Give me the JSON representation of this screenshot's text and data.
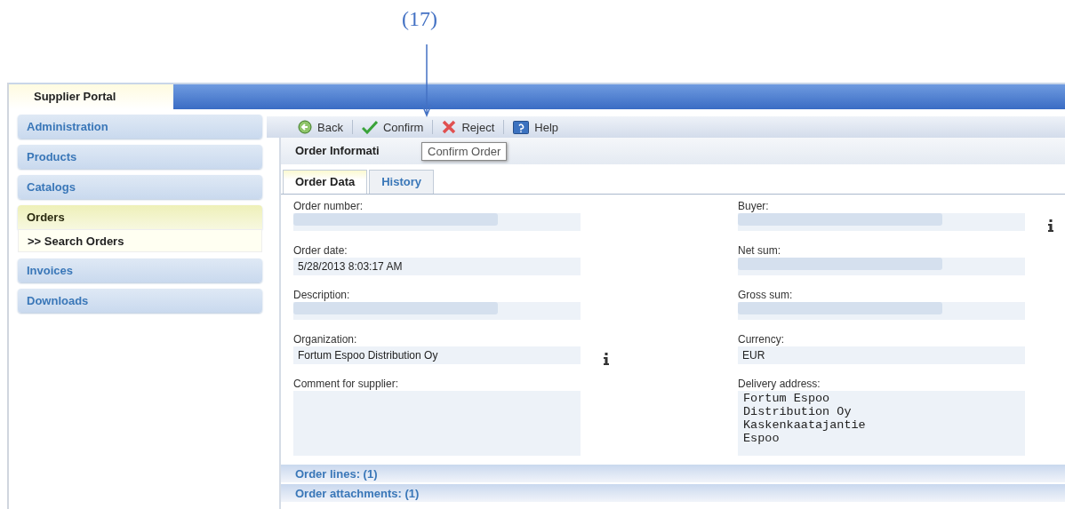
{
  "annotation": {
    "label": "(17)"
  },
  "portal_tab": {
    "label": "Supplier Portal",
    "selected": true
  },
  "sidebar": {
    "items": [
      {
        "label": "Administration",
        "selected": false
      },
      {
        "label": "Products",
        "selected": false
      },
      {
        "label": "Catalogs",
        "selected": false
      },
      {
        "label": "Orders",
        "selected": true,
        "children": [
          {
            "label": ">> Search Orders"
          }
        ]
      },
      {
        "label": "Invoices",
        "selected": false
      },
      {
        "label": "Downloads",
        "selected": false
      }
    ]
  },
  "toolbar": [
    {
      "label": "Back",
      "kind": "back"
    },
    {
      "label": "Confirm",
      "kind": "confirm"
    },
    {
      "label": "Reject",
      "kind": "reject"
    },
    {
      "label": "Help",
      "kind": "help"
    }
  ],
  "tooltip": "Confirm Order",
  "panel": {
    "title": "Order Informati",
    "tabs": [
      {
        "label": "Order Data",
        "selected": true
      },
      {
        "label": "History",
        "selected": false
      }
    ],
    "left_fields": [
      {
        "label": "Order number:",
        "redacted": true,
        "info": false,
        "kind": "text"
      },
      {
        "label": "Order date:",
        "value": "5/28/2013 8:03:17 AM",
        "redacted": false,
        "info": false,
        "kind": "text"
      },
      {
        "label": "Description:",
        "redacted": true,
        "info": false,
        "kind": "text"
      },
      {
        "label": "Organization:",
        "value": "Fortum Espoo Distribution Oy",
        "redacted": false,
        "info": true,
        "kind": "text"
      },
      {
        "label": "Comment for supplier:",
        "redacted": false,
        "info": false,
        "kind": "textarea"
      }
    ],
    "right_fields": [
      {
        "label": "Buyer:",
        "redacted": true,
        "info": true,
        "kind": "text"
      },
      {
        "label": "Net sum:",
        "redacted": true,
        "info": false,
        "kind": "text"
      },
      {
        "label": "Gross sum:",
        "redacted": true,
        "info": false,
        "kind": "text"
      },
      {
        "label": "Currency:",
        "value": "EUR",
        "redacted": false,
        "info": false,
        "kind": "text"
      },
      {
        "label": "Delivery address:",
        "value": "Fortum Espoo\nDistribution Oy\nKaskenkaatajantie\nEspoo",
        "redacted": false,
        "info": false,
        "kind": "textarea"
      }
    ],
    "sections": [
      {
        "label": "Order lines: (1)",
        "expanded": false
      },
      {
        "label": "Order attachments: (1)",
        "expanded": false
      }
    ]
  }
}
